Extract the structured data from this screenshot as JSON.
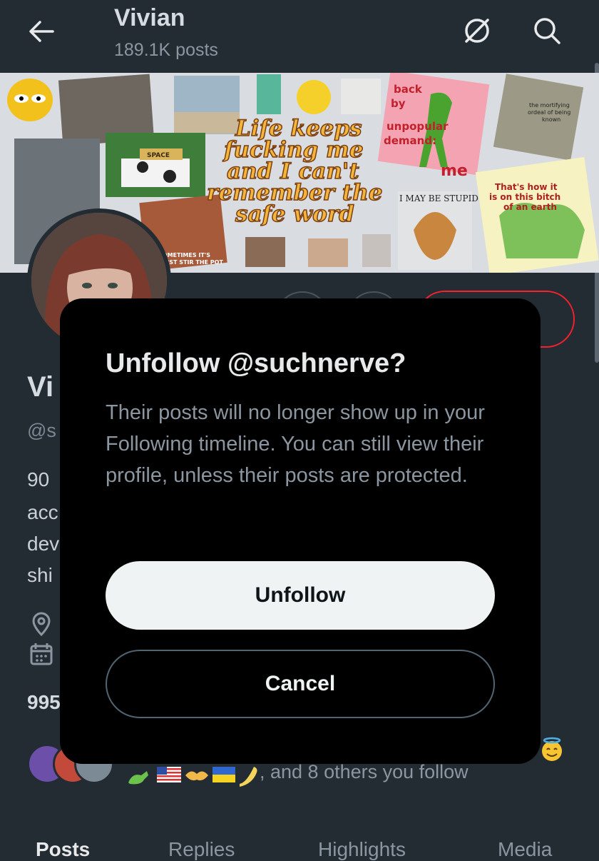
{
  "header": {
    "title": "Vivian",
    "post_count": "189.1K posts"
  },
  "banner": {
    "caption_main": [
      "Life keeps",
      "fucking me",
      "and I can't",
      "remember the",
      "safe word"
    ],
    "back_by": [
      "back",
      "by",
      "unpopular",
      "demand:"
    ],
    "me": "me",
    "stupid": "I MAY BE STUPID",
    "hows_it": [
      "That's how it",
      "is on this bitch",
      "of an earth"
    ],
    "mortifying": [
      "the mortifying",
      "ordeal of being",
      "known"
    ],
    "stir": [
      "SOMETIMES IT'S",
      "I JUST STIR THE POT"
    ],
    "space": "SPACE"
  },
  "profile": {
    "name_partial": "Vi",
    "handle_partial": "@s",
    "bio_partial": [
      "90",
      "acc",
      "dev",
      "shi"
    ],
    "count_partial": "995",
    "followers_you_know": ", and 8 others you follow"
  },
  "tabs": [
    "Posts",
    "Replies",
    "Highlights",
    "Media"
  ],
  "dialog": {
    "title": "Unfollow @suchnerve?",
    "body": "Their posts will no longer show up in your Following timeline. You can still view their profile, unless their posts are protected.",
    "confirm_label": "Unfollow",
    "cancel_label": "Cancel"
  },
  "colors": {
    "background": "#232b33",
    "dialog": "#000000",
    "confirm_button": "#eff3f4",
    "follow_outline": "#f4212e"
  }
}
